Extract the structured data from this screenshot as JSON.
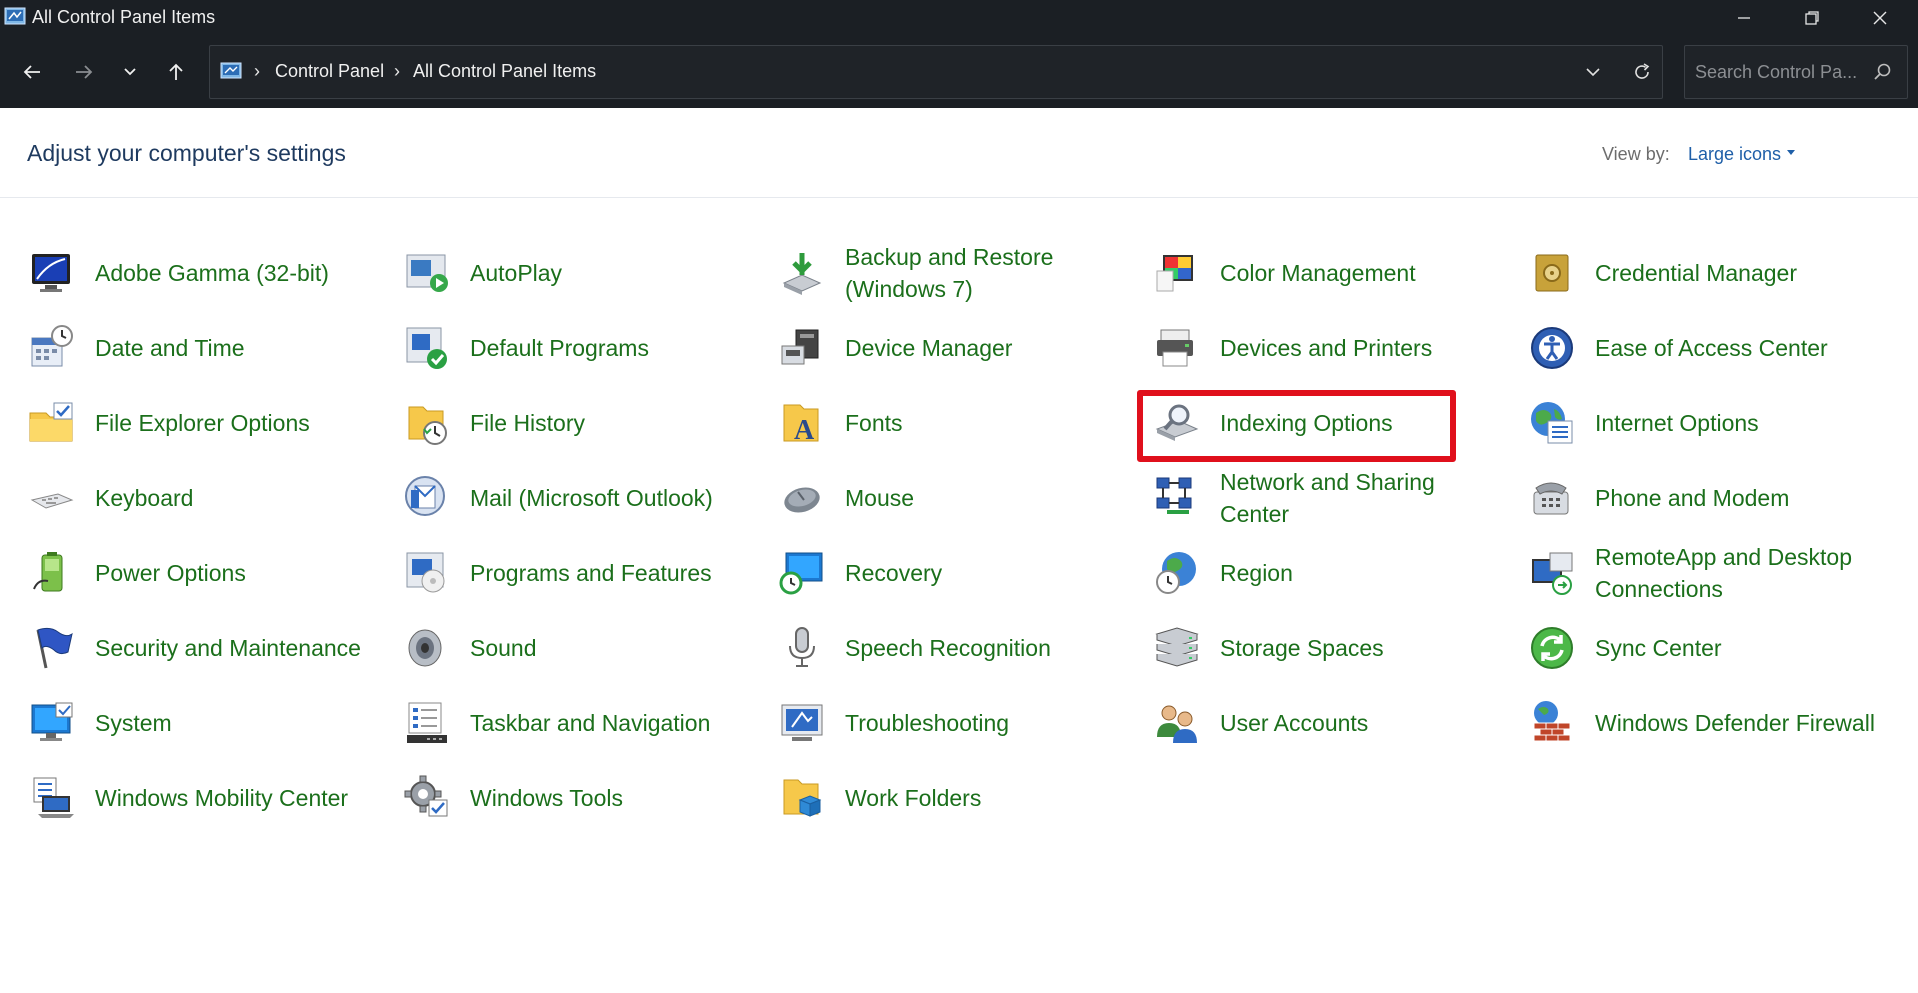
{
  "window": {
    "title": "All Control Panel Items"
  },
  "address_bar": {
    "crumbs": [
      "Control Panel",
      "All Control Panel Items"
    ],
    "search_placeholder": "Search Control Pa..."
  },
  "header": {
    "title": "Adjust your computer's settings",
    "view_by_label": "View by:",
    "view_by_value": "Large icons"
  },
  "items": [
    {
      "label": "Adobe Gamma (32-bit)",
      "icon": "monitor-gamma-icon"
    },
    {
      "label": "AutoPlay",
      "icon": "autoplay-icon"
    },
    {
      "label": "Backup and Restore (Windows 7)",
      "icon": "backup-icon"
    },
    {
      "label": "Color Management",
      "icon": "color-management-icon"
    },
    {
      "label": "Credential Manager",
      "icon": "vault-icon"
    },
    {
      "label": "Date and Time",
      "icon": "calendar-clock-icon"
    },
    {
      "label": "Default Programs",
      "icon": "default-programs-icon"
    },
    {
      "label": "Device Manager",
      "icon": "device-manager-icon"
    },
    {
      "label": "Devices and Printers",
      "icon": "printer-icon"
    },
    {
      "label": "Ease of Access Center",
      "icon": "ease-of-access-icon"
    },
    {
      "label": "File Explorer Options",
      "icon": "folder-options-icon"
    },
    {
      "label": "File History",
      "icon": "file-history-icon"
    },
    {
      "label": "Fonts",
      "icon": "fonts-icon"
    },
    {
      "label": "Indexing Options",
      "icon": "indexing-icon"
    },
    {
      "label": "Internet Options",
      "icon": "globe-icon"
    },
    {
      "label": "Keyboard",
      "icon": "keyboard-icon"
    },
    {
      "label": "Mail (Microsoft Outlook)",
      "icon": "mail-icon"
    },
    {
      "label": "Mouse",
      "icon": "mouse-icon"
    },
    {
      "label": "Network and Sharing Center",
      "icon": "network-icon"
    },
    {
      "label": "Phone and Modem",
      "icon": "phone-icon"
    },
    {
      "label": "Power Options",
      "icon": "battery-icon"
    },
    {
      "label": "Programs and Features",
      "icon": "programs-icon"
    },
    {
      "label": "Recovery",
      "icon": "recovery-icon"
    },
    {
      "label": "Region",
      "icon": "region-globe-icon"
    },
    {
      "label": "RemoteApp and Desktop Connections",
      "icon": "remote-desktop-icon"
    },
    {
      "label": "Security and Maintenance",
      "icon": "flag-icon"
    },
    {
      "label": "Sound",
      "icon": "speaker-icon"
    },
    {
      "label": "Speech Recognition",
      "icon": "microphone-icon"
    },
    {
      "label": "Storage Spaces",
      "icon": "storage-icon"
    },
    {
      "label": "Sync Center",
      "icon": "sync-icon"
    },
    {
      "label": "System",
      "icon": "system-monitor-icon"
    },
    {
      "label": "Taskbar and Navigation",
      "icon": "taskbar-icon"
    },
    {
      "label": "Troubleshooting",
      "icon": "troubleshooting-icon"
    },
    {
      "label": "User Accounts",
      "icon": "users-icon"
    },
    {
      "label": "Windows Defender Firewall",
      "icon": "firewall-icon"
    },
    {
      "label": "Windows Mobility Center",
      "icon": "mobility-icon"
    },
    {
      "label": "Windows Tools",
      "icon": "gear-tools-icon"
    },
    {
      "label": "Work Folders",
      "icon": "work-folders-icon"
    }
  ],
  "colors": {
    "titlebar": "#1b1f24",
    "item_text": "#1b6f1b",
    "title_text": "#1e3a5f",
    "link": "#1f5fa8",
    "highlight": "#e0101c"
  }
}
